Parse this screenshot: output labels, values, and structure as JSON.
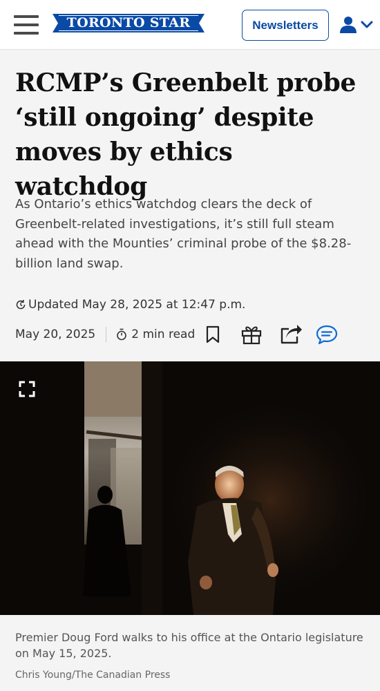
{
  "header": {
    "logo_text": "TORONTO STAR",
    "newsletters_label": "Newsletters",
    "brand_color": "#0a4aa5",
    "menu_icon": "hamburger-menu-icon",
    "account_icon": "user-account-icon"
  },
  "article": {
    "headline_lines": [
      "RCMP’s Greenbelt probe",
      "‘still ongoing’ despite",
      "moves by ethics watchdog"
    ],
    "deck": "As Ontario’s ethics watchdog clears the deck of Greenbelt-related investigations, it’s still full steam ahead with the Mounties’ criminal probe of the $8.28-billion land swap.",
    "updated": "Updated May 28, 2025 at 12:47 p.m.",
    "date": "May 20, 2025",
    "read_time": "2 min read",
    "actions": [
      "bookmark-icon",
      "gift-icon",
      "share-icon",
      "comments-icon"
    ]
  },
  "photo": {
    "caption": "Premier Doug Ford walks to his office at the Ontario legislature on May 15, 2025.",
    "credit": "Chris Young/The Canadian Press",
    "expand_icon": "fullscreen-expand-icon"
  }
}
